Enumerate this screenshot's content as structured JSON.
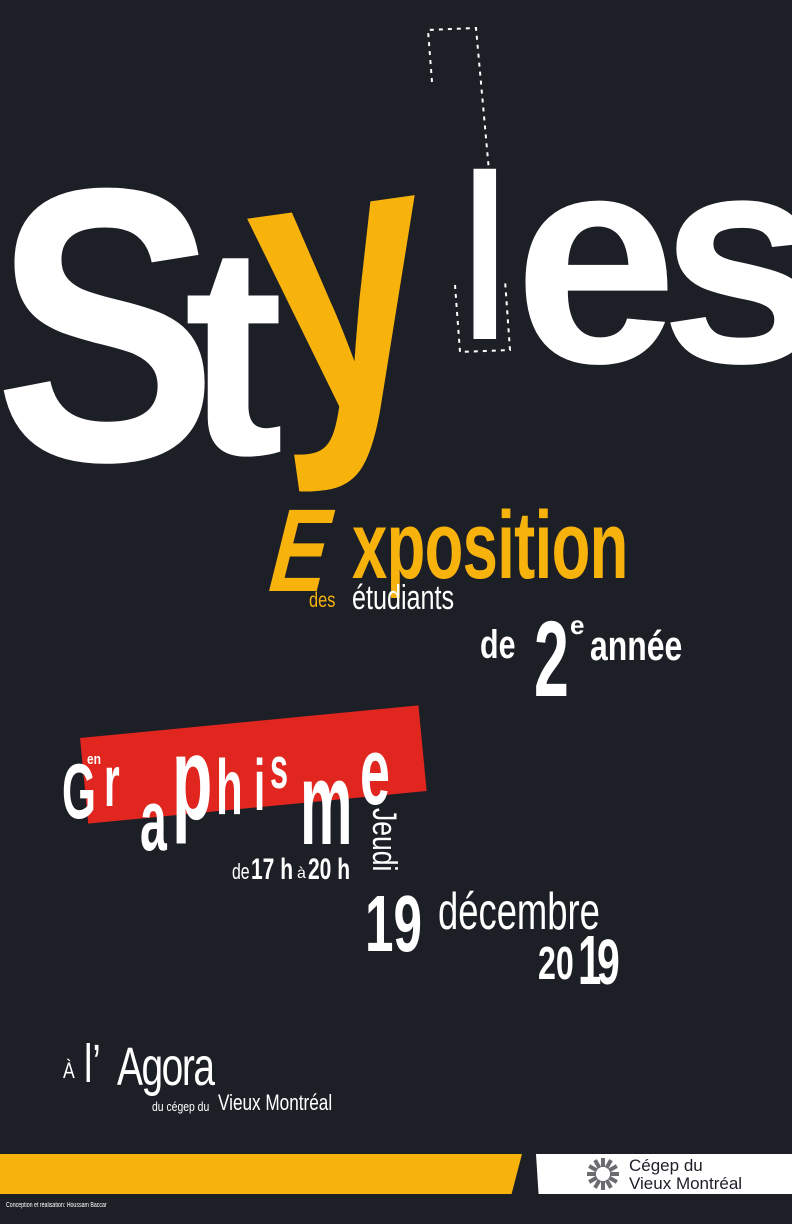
{
  "title": {
    "l1": "S",
    "l2": "t",
    "l3": "y",
    "l4": "l",
    "l5": "es"
  },
  "exposition": {
    "initial": "E",
    "rest": "xposition",
    "des": "des",
    "etudiants": "étudiants",
    "de": "de",
    "num": "2",
    "sup": "e",
    "annee": "année"
  },
  "program": {
    "prefix": "en",
    "g": "G",
    "r": "r",
    "a": "a",
    "p": "p",
    "h": "h",
    "i": "i",
    "s": "s",
    "m": "m",
    "e": "e"
  },
  "date": {
    "weekday": "Jeudi",
    "de": "de",
    "start": "17 h",
    "a": "à",
    "end": "20 h",
    "day": "19",
    "month": "décembre",
    "y1": "20",
    "y2": "1",
    "y3": "9"
  },
  "place": {
    "a": "À",
    "name_l": "l’",
    "name_rest": "Agora",
    "sub_du": "du cégep du",
    "sub_name": "Vieux Montréal"
  },
  "footer": {
    "credit": "Conception et réalisation: Houssam Baccar",
    "logo_line1": "Cégep du",
    "logo_line2": "Vieux Montréal"
  },
  "colors": {
    "background": "#1d1f26",
    "accent": "#f7b20c",
    "red": "#e0261f",
    "text": "#ffffff"
  }
}
